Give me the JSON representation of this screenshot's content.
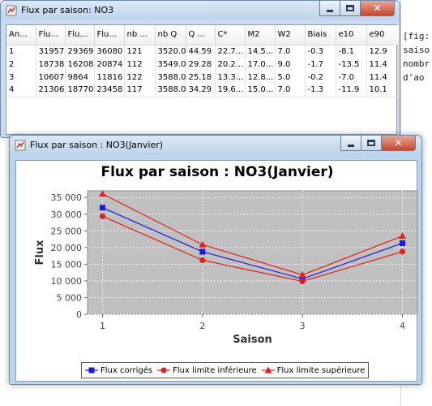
{
  "background_editor": {
    "lines": [
      "[fig:",
      "saiso",
      "nombr",
      "d'ao"
    ]
  },
  "table_window": {
    "title": "Flux par saison: NO3",
    "columns": [
      "An...",
      "Flu...",
      "Flu...",
      "Flu...",
      "nb ...",
      "nb Q",
      "Q ...",
      "C*",
      "M2",
      "W2",
      "Biais",
      "e10",
      "e90"
    ],
    "rows": [
      [
        "1",
        "31957",
        "29369",
        "36080",
        "121",
        "3520.0",
        "44.59",
        "22.7...",
        "14.5...",
        "7.0",
        "-0.3",
        "-8.1",
        "12.9"
      ],
      [
        "2",
        "18738",
        "16208",
        "20874",
        "112",
        "3549.0",
        "29.28",
        "20.2...",
        "17.0...",
        "9.0",
        "-1.7",
        "-13.5",
        "11.4"
      ],
      [
        "3",
        "10607",
        "9864",
        "11816",
        "122",
        "3588.0",
        "25.18",
        "13.3...",
        "12.8...",
        "5.0",
        "-0.2",
        "-7.0",
        "11.4"
      ],
      [
        "4",
        "21306",
        "18770",
        "23458",
        "117",
        "3588.0",
        "34.29",
        "19.6...",
        "15.0...",
        "7.0",
        "-1.3",
        "-11.9",
        "10.1"
      ]
    ]
  },
  "chart_window": {
    "title": "Flux par saison : NO3(Janvier)"
  },
  "chart_data": {
    "type": "line",
    "title": "Flux par saison : NO3(Janvier)",
    "xlabel": "Saison",
    "ylabel": "Flux",
    "x": [
      1,
      2,
      3,
      4
    ],
    "x_ticks": [
      "1",
      "2",
      "3",
      "4"
    ],
    "y_ticks": [
      "0",
      "5 000",
      "10 000",
      "15 000",
      "20 000",
      "25 000",
      "30 000",
      "35 000"
    ],
    "ylim": [
      0,
      37000
    ],
    "grid": true,
    "legend_position": "bottom",
    "series": [
      {
        "name": "Flux corrigés",
        "values": [
          31957,
          18738,
          10607,
          21306
        ],
        "color": "#1a1adc",
        "marker": "square"
      },
      {
        "name": "Flux limite inférieure",
        "values": [
          29369,
          16208,
          9864,
          18770
        ],
        "color": "#e0221b",
        "marker": "circle"
      },
      {
        "name": "Flux limite supérieure",
        "values": [
          36080,
          20874,
          11816,
          23458
        ],
        "color": "#e0221b",
        "marker": "triangle"
      }
    ]
  }
}
